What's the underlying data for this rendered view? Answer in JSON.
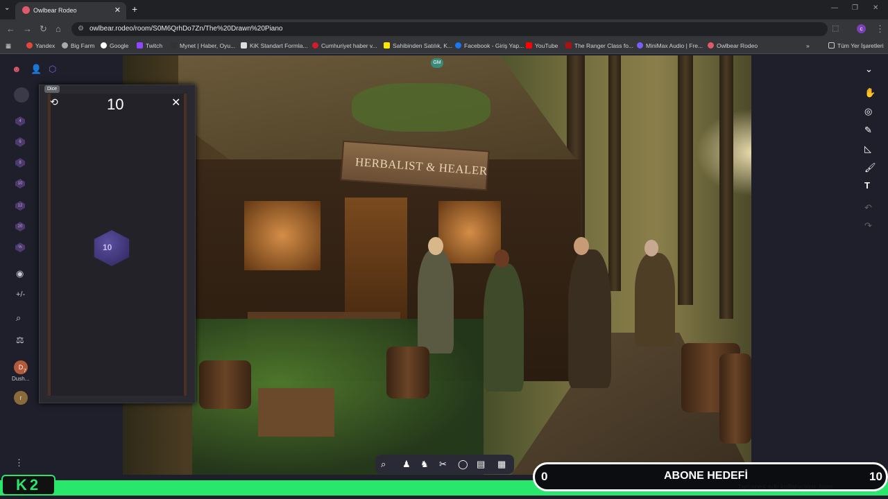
{
  "browser": {
    "tab_title": "Owlbear Rodeo",
    "url": "owlbear.rodeo/room/S0M6QrhDo7Zn/The%20Drawn%20Piano",
    "bookmarks": [
      "Yandex",
      "Big Farm",
      "Google",
      "Twitch",
      "Mynet | Haber, Oyu...",
      "KiK Standart Formla...",
      "Cumhuriyet haber v...",
      "Sahibinden Satılık, K...",
      "Facebook - Giriş Yap...",
      "YouTube",
      "The Ranger Class fo...",
      "MiniMax Audio | Fre...",
      "Owlbear Rodeo"
    ],
    "all_bookmarks_label": "Tüm Yer İşaretleri",
    "profile_initial": "c"
  },
  "app": {
    "dice_panel": {
      "tooltip": "Dice",
      "total": "10",
      "die_face": "10"
    },
    "left_rail": {
      "dice_labels": [
        "4",
        "6",
        "8",
        "10",
        "12",
        "20",
        "%"
      ],
      "visibility_label": "+/-",
      "player_name": "Dush...",
      "player_badge": "7",
      "player_initial": "D",
      "other_initial": "r"
    },
    "map": {
      "sign_text": "HERBALIST & HEALER",
      "gm_badge": "GM"
    }
  },
  "stream_overlay": {
    "logo": "K2",
    "goal_min": "0",
    "goal_label": "ABONE HEDEFİ",
    "goal_max": "10",
    "ticker": "Tarcanes adlı kullanıcının Jam!"
  }
}
